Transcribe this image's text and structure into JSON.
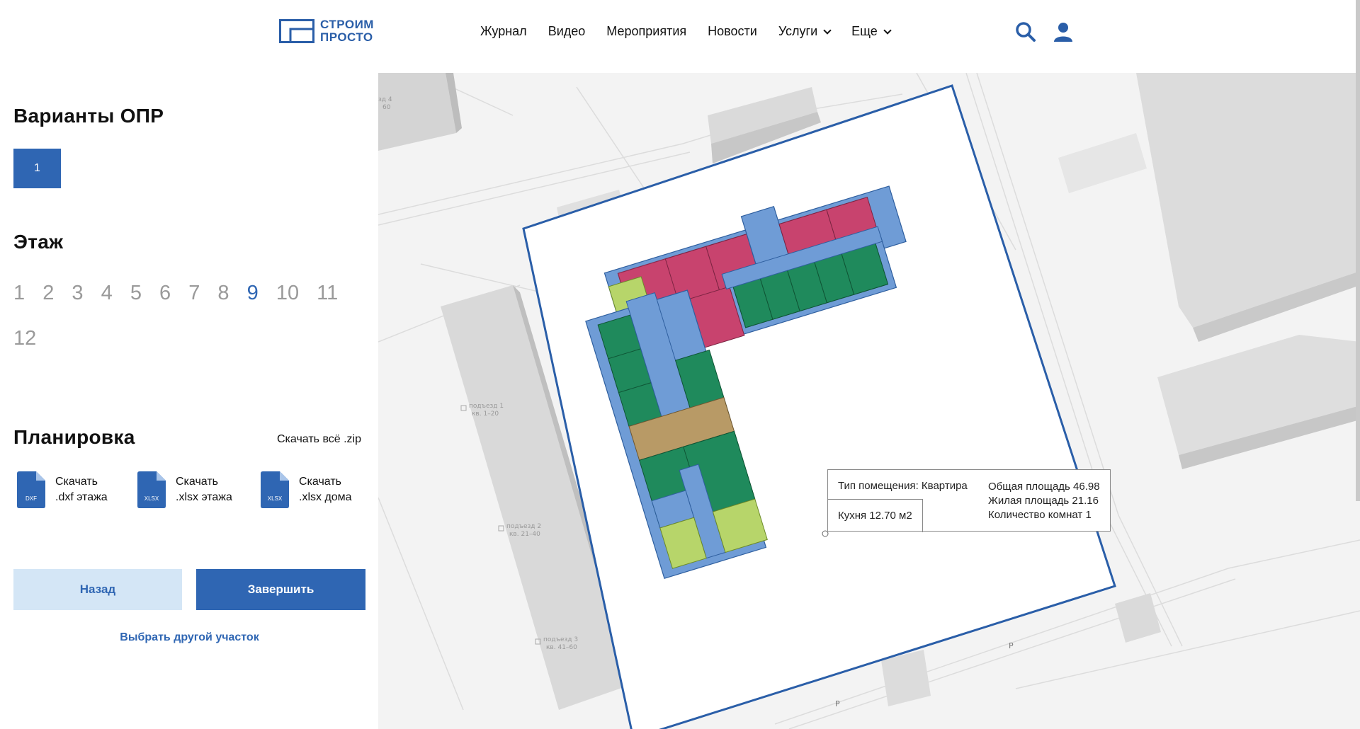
{
  "header": {
    "logo_line1": "СТРОИМ",
    "logo_line2": "ПРОСТО",
    "nav": [
      {
        "label": "Журнал",
        "has_dropdown": false
      },
      {
        "label": "Видео",
        "has_dropdown": false
      },
      {
        "label": "Мероприятия",
        "has_dropdown": false
      },
      {
        "label": "Новости",
        "has_dropdown": false
      },
      {
        "label": "Услуги",
        "has_dropdown": true
      },
      {
        "label": "Еще",
        "has_dropdown": true
      }
    ],
    "icons": [
      "search-icon",
      "user-icon"
    ]
  },
  "sidebar": {
    "variants_title": "Варианты ОПР",
    "variants": [
      "1"
    ],
    "floor_title": "Этаж",
    "floors": [
      "1",
      "2",
      "3",
      "4",
      "5",
      "6",
      "7",
      "8",
      "9",
      "10",
      "11",
      "12"
    ],
    "active_floor": "9",
    "layout_title": "Планировка",
    "download_all": "Скачать всё .zip",
    "files": [
      {
        "ext": "DXF",
        "line1": "Скачать",
        "line2": ".dxf этажа"
      },
      {
        "ext": "XLSX",
        "line1": "Скачать",
        "line2": ".xlsx этажа"
      },
      {
        "ext": "XLSX",
        "line1": "Скачать",
        "line2": ".xlsx дома"
      }
    ],
    "back_label": "Назад",
    "finish_label": "Завершить",
    "other_plot_label": "Выбрать другой участок"
  },
  "map": {
    "entrances": [
      {
        "name": "подъезд 1",
        "flats": "кв. 1–20"
      },
      {
        "name": "подъезд 2",
        "flats": "кв. 21–40"
      },
      {
        "name": "подъезд 3",
        "flats": "кв. 41–60"
      },
      {
        "name": "зд 4",
        "flats": "60"
      }
    ],
    "parking_labels": [
      "P",
      "P"
    ],
    "colors": {
      "plot_border": "#2a5ea8",
      "core": "#6f9cd6",
      "apartment_red": "#c8436e",
      "apartment_green": "#1f8a5c",
      "apartment_lightgreen": "#b7d56a",
      "apartment_brown": "#b89a66"
    }
  },
  "tooltip": {
    "type": "Тип помещения: Квартира",
    "kitchen": "Кухня 12.70 м2",
    "total_area": "Общая площадь 46.98",
    "living_area": "Жилая площадь 21.16",
    "rooms": "Количество комнат 1"
  }
}
